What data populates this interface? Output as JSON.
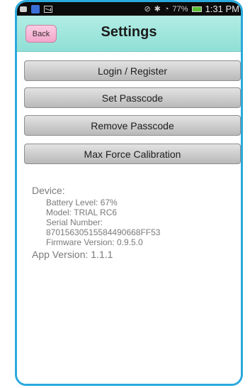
{
  "statusbar": {
    "signal_text": "77%",
    "time": "1:31 PM"
  },
  "header": {
    "back_label": "Back",
    "title": "Settings"
  },
  "menu": [
    {
      "label": "Login / Register"
    },
    {
      "label": "Set Passcode"
    },
    {
      "label": "Remove Passcode"
    },
    {
      "label": "Max Force Calibration"
    }
  ],
  "device_info": {
    "heading": "Device:",
    "battery": "Battery Level: 67%",
    "model": "Model: TRIAL RC6",
    "serial_label": "Serial Number:",
    "serial_value": "8701563051558449066​8FF53",
    "firmware": "Firmware Version: 0.9.5.0"
  },
  "app_version": "App Version: 1.1.1",
  "colors": {
    "accent_border": "#2aa9dc",
    "titlebar": "#a6e8df",
    "back_button": "#f6b2d2"
  }
}
